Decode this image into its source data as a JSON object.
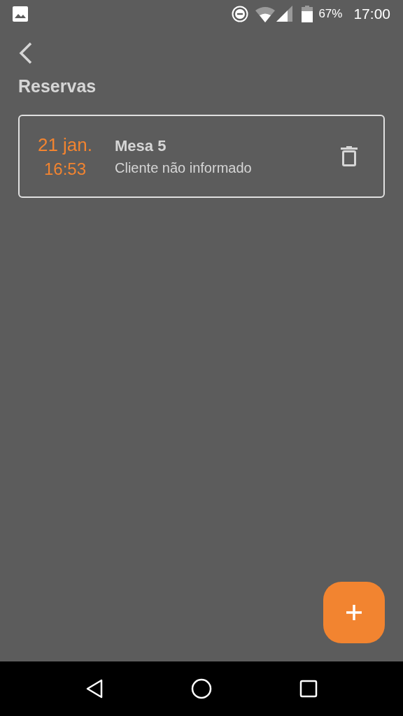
{
  "status_bar": {
    "battery": "67%",
    "time": "17:00"
  },
  "page": {
    "title": "Reservas"
  },
  "reservations": [
    {
      "date": "21 jan.",
      "time": "16:53",
      "table": "Mesa 5",
      "client": "Cliente não informado"
    }
  ]
}
